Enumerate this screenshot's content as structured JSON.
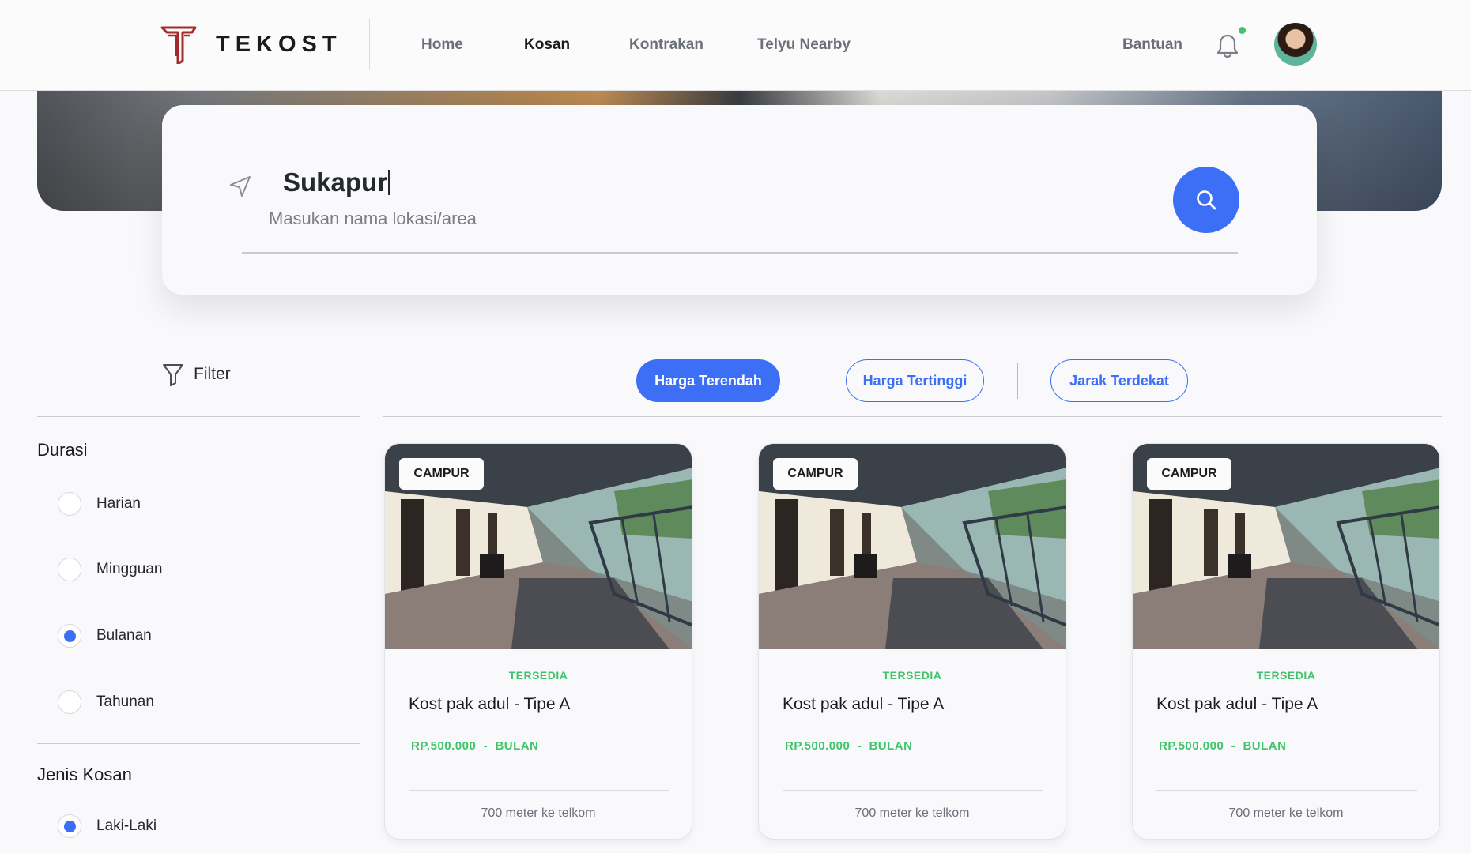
{
  "brand": {
    "name": "TEKOST",
    "accent": "#a32b2b"
  },
  "nav": {
    "links": [
      {
        "label": "Home",
        "active": false
      },
      {
        "label": "Kosan",
        "active": true
      },
      {
        "label": "Kontrakan",
        "active": false
      },
      {
        "label": "Telyu Nearby",
        "active": false
      }
    ],
    "help": "Bantuan",
    "icons": [
      "bell-icon",
      "avatar"
    ],
    "notification_dot_color": "#3fc46b"
  },
  "search": {
    "value": "Sukapur",
    "hint": "Masukan nama lokasi/area",
    "icons": [
      "navigation-arrow-icon",
      "search-icon"
    ],
    "button_color": "#3c6ff5"
  },
  "filter": {
    "label": "Filter",
    "icon": "funnel-icon",
    "sections": [
      {
        "title": "Durasi",
        "options": [
          {
            "label": "Harian",
            "checked": false
          },
          {
            "label": "Mingguan",
            "checked": false
          },
          {
            "label": "Bulanan",
            "checked": true
          },
          {
            "label": "Tahunan",
            "checked": false
          }
        ]
      },
      {
        "title": "Jenis Kosan",
        "options": [
          {
            "label": "Laki-Laki",
            "checked": true
          }
        ]
      }
    ]
  },
  "sort": {
    "options": [
      {
        "label": "Harga Terendah",
        "active": true
      },
      {
        "label": "Harga Tertinggi",
        "active": false
      },
      {
        "label": "Jarak Terdekat",
        "active": false
      }
    ]
  },
  "listings": [
    {
      "tag": "CAMPUR",
      "status": "TERSEDIA",
      "title": "Kost pak adul - Tipe A",
      "price": "RP.500.000",
      "period": "BULAN",
      "distance": "700 meter ke telkom"
    },
    {
      "tag": "CAMPUR",
      "status": "TERSEDIA",
      "title": "Kost pak adul - Tipe A",
      "price": "RP.500.000",
      "period": "BULAN",
      "distance": "700 meter ke telkom"
    },
    {
      "tag": "CAMPUR",
      "status": "TERSEDIA",
      "title": "Kost pak adul - Tipe A",
      "price": "RP.500.000",
      "period": "BULAN",
      "distance": "700 meter ke telkom"
    }
  ],
  "colors": {
    "primary": "#3c6ff5",
    "success": "#3fc46b",
    "text": "#1b1b1f",
    "muted": "#6b6f78"
  }
}
